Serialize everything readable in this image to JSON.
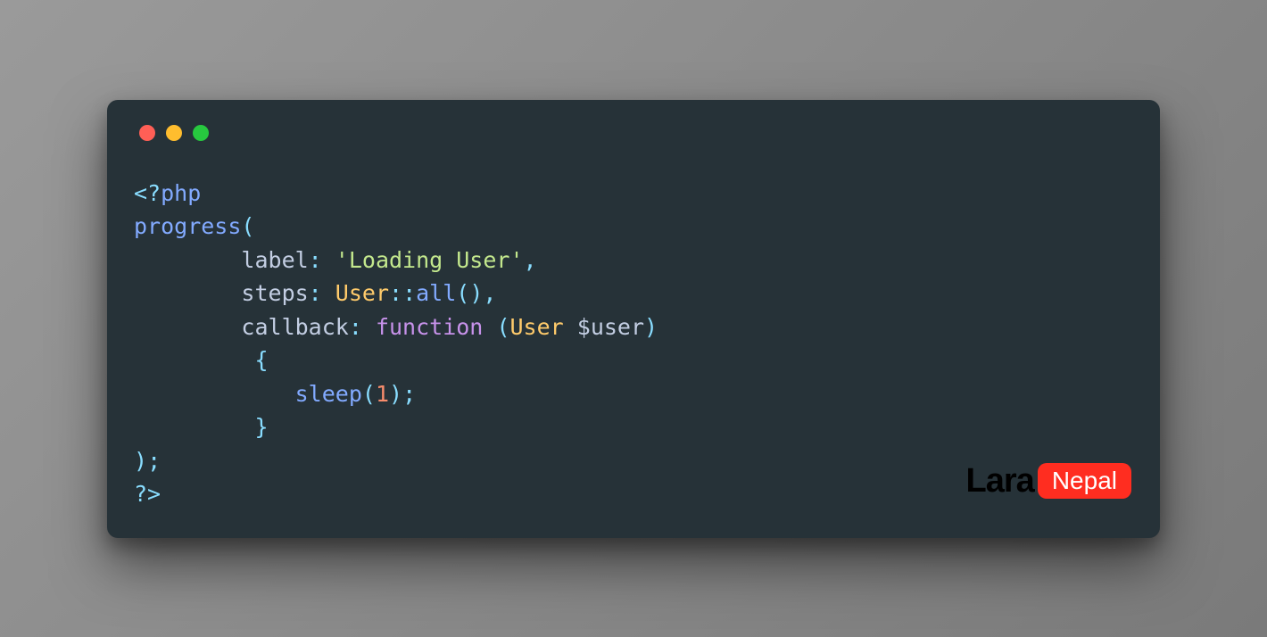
{
  "code": {
    "tokens": [
      {
        "t": "<?",
        "c": "t-punct"
      },
      {
        "t": "php",
        "c": "t-keyword"
      },
      {
        "t": "\n",
        "c": ""
      },
      {
        "t": "progress",
        "c": "t-func"
      },
      {
        "t": "(",
        "c": "t-punct"
      },
      {
        "t": "\n",
        "c": ""
      },
      {
        "t": "        label",
        "c": "t-default"
      },
      {
        "t": ":",
        "c": "t-punct"
      },
      {
        "t": " ",
        "c": ""
      },
      {
        "t": "'Loading User'",
        "c": "t-string"
      },
      {
        "t": ",",
        "c": "t-punct"
      },
      {
        "t": "\n",
        "c": ""
      },
      {
        "t": "        steps",
        "c": "t-default"
      },
      {
        "t": ":",
        "c": "t-punct"
      },
      {
        "t": " ",
        "c": ""
      },
      {
        "t": "User",
        "c": "t-class"
      },
      {
        "t": "::",
        "c": "t-punct"
      },
      {
        "t": "all",
        "c": "t-func"
      },
      {
        "t": "()",
        "c": "t-punct"
      },
      {
        "t": ",",
        "c": "t-punct"
      },
      {
        "t": "\n",
        "c": ""
      },
      {
        "t": "        callback",
        "c": "t-default"
      },
      {
        "t": ":",
        "c": "t-punct"
      },
      {
        "t": " ",
        "c": ""
      },
      {
        "t": "function",
        "c": "t-kw2"
      },
      {
        "t": " ",
        "c": ""
      },
      {
        "t": "(",
        "c": "t-punct"
      },
      {
        "t": "User",
        "c": "t-class"
      },
      {
        "t": " ",
        "c": ""
      },
      {
        "t": "$user",
        "c": "t-var"
      },
      {
        "t": ")",
        "c": "t-punct"
      },
      {
        "t": "\n",
        "c": ""
      },
      {
        "t": "         {",
        "c": "t-punct"
      },
      {
        "t": "\n",
        "c": ""
      },
      {
        "t": "            ",
        "c": ""
      },
      {
        "t": "sleep",
        "c": "t-func"
      },
      {
        "t": "(",
        "c": "t-punct"
      },
      {
        "t": "1",
        "c": "t-num"
      },
      {
        "t": ")",
        "c": "t-punct"
      },
      {
        "t": ";",
        "c": "t-punct"
      },
      {
        "t": "\n",
        "c": ""
      },
      {
        "t": "         }",
        "c": "t-punct"
      },
      {
        "t": "\n",
        "c": ""
      },
      {
        "t": ")",
        "c": "t-punct"
      },
      {
        "t": ";",
        "c": "t-punct"
      },
      {
        "t": "\n",
        "c": ""
      },
      {
        "t": "?>",
        "c": "t-punct"
      }
    ]
  },
  "logo": {
    "part1": "Lara",
    "part2": "Nepal"
  }
}
